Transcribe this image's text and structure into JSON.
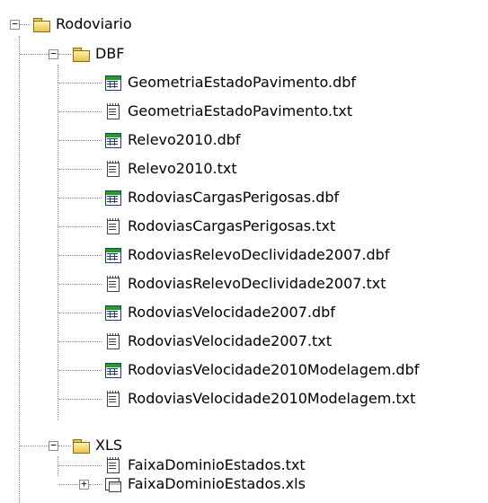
{
  "tree": {
    "root": {
      "label": "Rodoviario",
      "icon": "folder-icon",
      "expanded": true
    },
    "folders": [
      {
        "label": "DBF",
        "icon": "folder-icon",
        "expanded": true,
        "files": [
          {
            "label": "GeometriaEstadoPavimento.dbf",
            "icon": "dbf-table-icon"
          },
          {
            "label": "GeometriaEstadoPavimento.txt",
            "icon": "txt-notepad-icon"
          },
          {
            "label": "Relevo2010.dbf",
            "icon": "dbf-table-icon"
          },
          {
            "label": "Relevo2010.txt",
            "icon": "txt-notepad-icon"
          },
          {
            "label": "RodoviasCargasPerigosas.dbf",
            "icon": "dbf-table-icon"
          },
          {
            "label": "RodoviasCargasPerigosas.txt",
            "icon": "txt-notepad-icon"
          },
          {
            "label": "RodoviasRelevoDeclividade2007.dbf",
            "icon": "dbf-table-icon"
          },
          {
            "label": "RodoviasRelevoDeclividade2007.txt",
            "icon": "txt-notepad-icon"
          },
          {
            "label": "RodoviasVelocidade2007.dbf",
            "icon": "dbf-table-icon"
          },
          {
            "label": "RodoviasVelocidade2007.txt",
            "icon": "txt-notepad-icon"
          },
          {
            "label": "RodoviasVelocidade2010Modelagem.dbf",
            "icon": "dbf-table-icon"
          },
          {
            "label": "RodoviasVelocidade2010Modelagem.txt",
            "icon": "txt-notepad-icon"
          }
        ]
      },
      {
        "label": "XLS",
        "icon": "folder-icon",
        "expanded": true,
        "files": [
          {
            "label": "FaixaDominioEstados.txt",
            "icon": "txt-notepad-icon"
          },
          {
            "label": "FaixaDominioEstados.xls",
            "icon": "xls-sheet-icon",
            "expandable": true
          }
        ]
      }
    ],
    "expander_symbols": {
      "collapse": "−",
      "expand": "+"
    }
  }
}
